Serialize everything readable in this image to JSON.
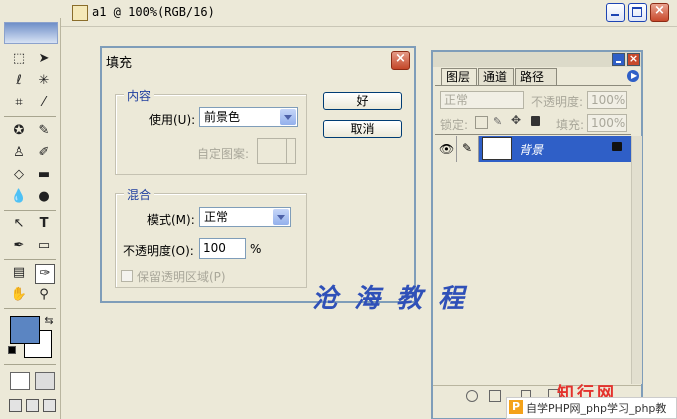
{
  "window": {
    "title": "a1 @ 100%(RGB/16)",
    "buttons": [
      "minimize",
      "maximize",
      "close"
    ]
  },
  "toolbox": {
    "icons": [
      "rect-marquee-icon",
      "move-icon",
      "lasso-icon",
      "magic-wand-icon",
      "crop-icon",
      "eyedropper-icon",
      "healing-icon",
      "brush-icon",
      "stamp-icon",
      "history-brush-icon",
      "eraser-icon",
      "gradient-icon",
      "blur-icon",
      "dodge-icon",
      "path-select-icon",
      "type-icon",
      "pen-icon",
      "shape-icon",
      "notes-icon",
      "eyedropper-icon",
      "hand-icon",
      "zoom-icon"
    ],
    "foreground_color": "#5b85c2",
    "background_color": "#ffffff"
  },
  "fill_dialog": {
    "title": "填充",
    "content_group": "内容",
    "use_label": "使用(U):",
    "use_value": "前景色",
    "pattern_label": "自定图案:",
    "blend_group": "混合",
    "mode_label": "模式(M):",
    "mode_value": "正常",
    "opacity_label": "不透明度(O):",
    "opacity_value": "100",
    "opacity_unit": "%",
    "preserve_label": "保留透明区域(P)",
    "ok_label": "好",
    "cancel_label": "取消"
  },
  "layers_panel": {
    "tabs": [
      "图层",
      "通道",
      "路径"
    ],
    "blend_mode": "正常",
    "opacity_label": "不透明度:",
    "opacity_value": "100%",
    "lock_label": "锁定:",
    "fill_label": "填充:",
    "fill_value": "100%",
    "layer_name": "背景"
  },
  "watermark": "沧海教程",
  "site_logo": "知行网",
  "site_banner": "自学PHP网_php学习_php教"
}
